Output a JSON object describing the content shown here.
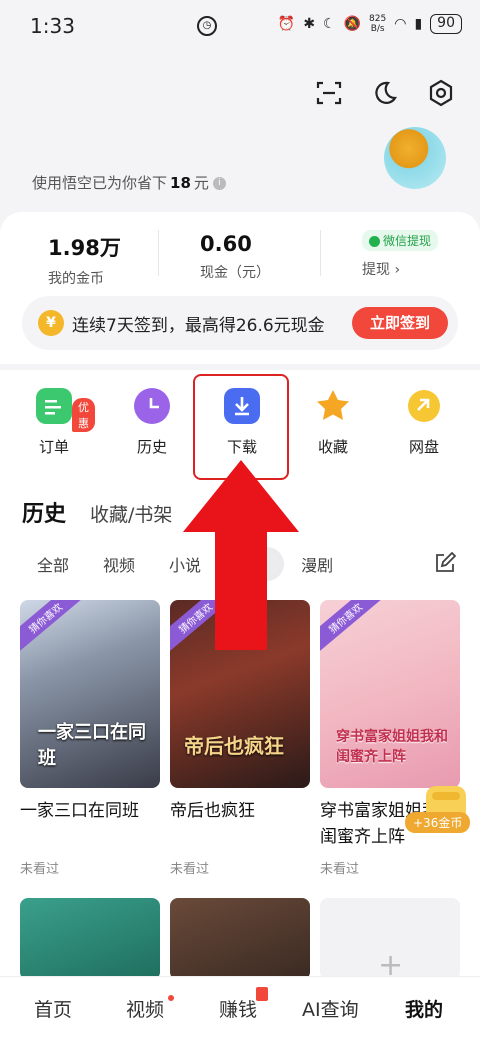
{
  "status": {
    "time": "1:33",
    "net_speed_value": "825",
    "net_speed_unit": "B/s",
    "battery": "90"
  },
  "header": {
    "saved_prefix": "使用悟空已为你省下",
    "saved_amount": "18",
    "saved_unit": "元"
  },
  "stats": {
    "coins_value": "1.98万",
    "coins_label": "我的金币",
    "cash_value": "0.60",
    "cash_label": "现金（元）",
    "wechat_badge": "微信提现",
    "withdraw_label": "提现"
  },
  "checkin": {
    "coin_symbol": "¥",
    "text": "连续7天签到，最高得26.6元现金",
    "button": "立即签到"
  },
  "quick": {
    "items": [
      {
        "label": "订单",
        "badge": "优惠"
      },
      {
        "label": "历史"
      },
      {
        "label": "下载"
      },
      {
        "label": "收藏"
      },
      {
        "label": "网盘"
      }
    ]
  },
  "history": {
    "tab_history": "历史",
    "tab_favorites": "收藏/书架",
    "filters": [
      "全部",
      "视频",
      "小说",
      "短剧",
      "漫剧"
    ],
    "active_filter": "短剧",
    "items": [
      {
        "ribbon": "猜你喜欢",
        "poster_text": "一家三口在同班",
        "title": "一家三口在同班",
        "status": "未看过"
      },
      {
        "ribbon": "猜你喜欢",
        "poster_text": "帝后也疯狂",
        "title": "帝后也疯狂",
        "status": "未看过"
      },
      {
        "ribbon": "猜你喜欢",
        "poster_text": "穿书富家姐姐我和闺蜜齐上阵",
        "title": "穿书富家姐姐我和闺蜜齐上阵",
        "status": "未看过"
      }
    ],
    "reward": "+36金币",
    "add_symbol": "+"
  },
  "colors": {
    "accent_red": "#f2473b",
    "highlight_red": "#d22",
    "wechat_green": "#22a24a"
  },
  "nav": {
    "items": [
      "首页",
      "视频",
      "赚钱",
      "AI查询",
      "我的"
    ],
    "active": "我的"
  }
}
